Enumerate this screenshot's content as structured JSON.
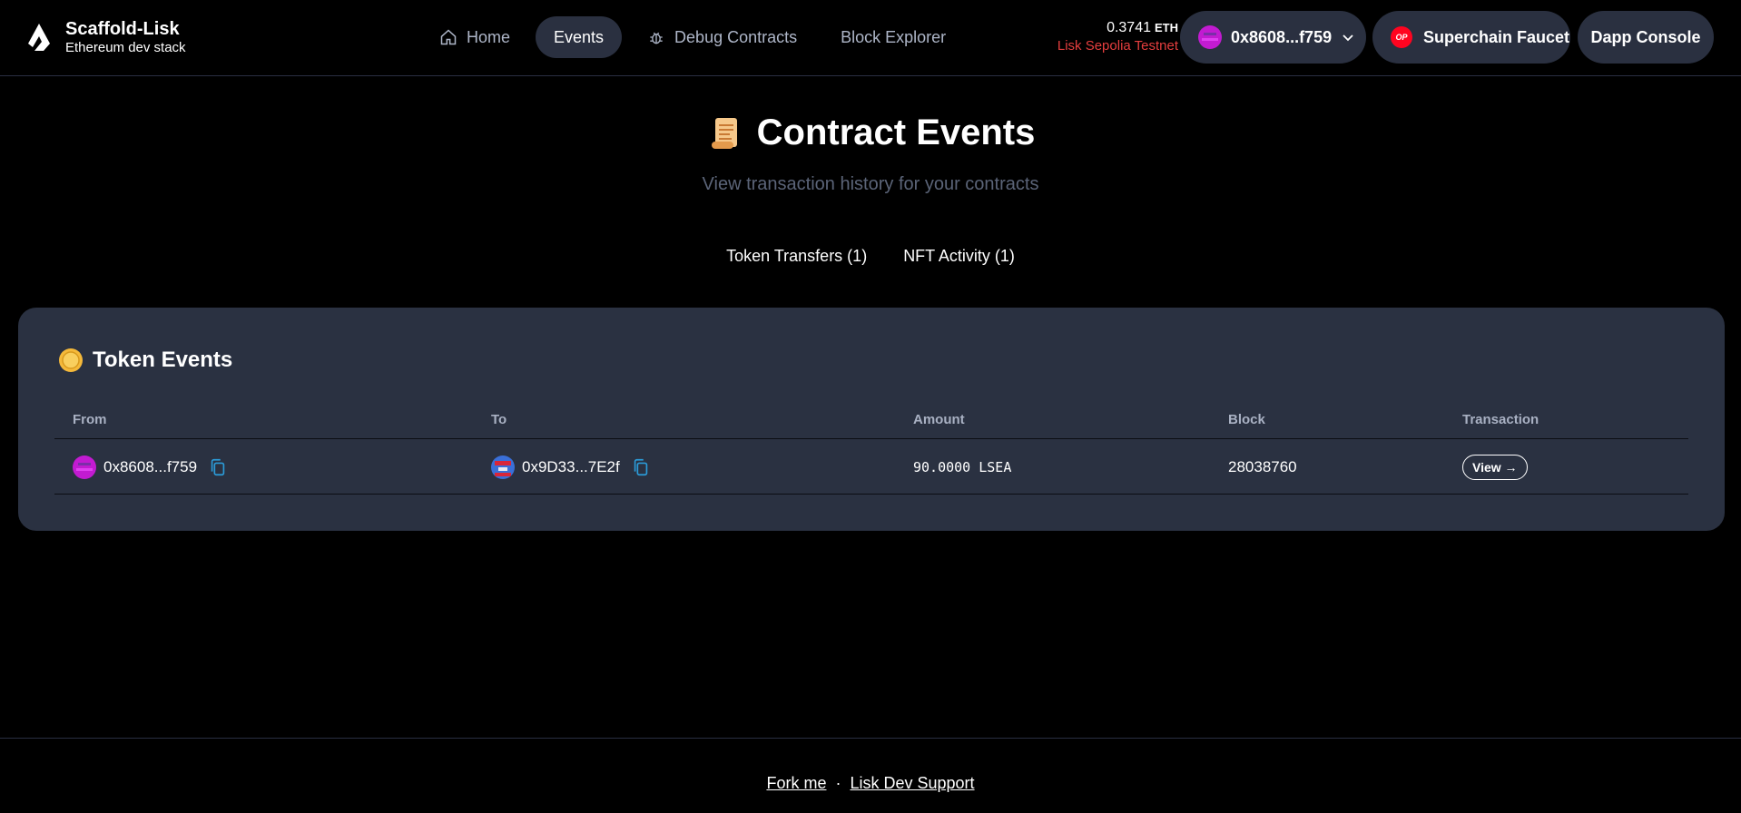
{
  "header": {
    "brand_title": "Scaffold-Lisk",
    "brand_subtitle": "Ethereum dev stack",
    "nav": [
      {
        "label": "Home",
        "icon": "home-icon"
      },
      {
        "label": "Events",
        "icon": ""
      },
      {
        "label": "Debug Contracts",
        "icon": "bug-icon"
      },
      {
        "label": "Block Explorer",
        "icon": ""
      }
    ],
    "balance_value": "0.3741",
    "balance_unit": "ETH",
    "network": "Lisk Sepolia Testnet",
    "wallet_address": "0x8608...f759",
    "faucet_badge": "OP",
    "faucet_label": "Superchain Faucet",
    "console_label": "Dapp Console"
  },
  "hero": {
    "title": "Contract Events",
    "subtitle": "View transaction history for your contracts"
  },
  "tabs": [
    "Token Transfers (1)",
    "NFT Activity (1)"
  ],
  "card": {
    "title": "Token Events",
    "columns": [
      "From",
      "To",
      "Amount",
      "Block",
      "Transaction"
    ],
    "rows": [
      {
        "from": "0x8608...f759",
        "to": "0x9D33...7E2f",
        "amount": "90.0000 LSEA",
        "block": "28038760",
        "tx": "View →"
      }
    ]
  },
  "footer": {
    "link1": "Fork me",
    "separator": "·",
    "link2": "Lisk Dev Support"
  },
  "colors": {
    "background": "#000000",
    "card": "#2a3141",
    "pill": "#2a3040",
    "network_red": "#e53e3e",
    "copy_blue": "#2b9bd8",
    "muted": "#5b6478"
  }
}
